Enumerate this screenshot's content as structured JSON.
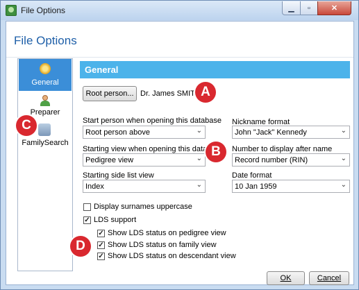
{
  "window": {
    "title": "File Options",
    "min_glyph": "▁",
    "max_glyph": "▫",
    "close_glyph": "✕"
  },
  "dialog": {
    "title": "File Options"
  },
  "sidebar": {
    "items": [
      {
        "label": "General",
        "icon": "gear-icon",
        "selected": true
      },
      {
        "label": "Preparer",
        "icon": "person-icon",
        "selected": false
      },
      {
        "label": "FamilySearch",
        "icon": "familysearch-icon",
        "selected": false
      }
    ]
  },
  "section": {
    "title": "General"
  },
  "root": {
    "button_label": "Root person...",
    "name": "Dr. James SMITH"
  },
  "fields": {
    "start_person": {
      "label": "Start person when opening this database",
      "value": "Root person above"
    },
    "starting_view": {
      "label": "Starting view when opening this database",
      "value": "Pedigree view"
    },
    "side_list": {
      "label": "Starting side list view",
      "value": "Index"
    },
    "nickname": {
      "label": "Nickname format",
      "value": "John \"Jack\" Kennedy"
    },
    "number_display": {
      "label": "Number to display after name",
      "value": "Record number (RIN)"
    },
    "date_format": {
      "label": "Date format",
      "value": "10 Jan 1959"
    }
  },
  "checkboxes": {
    "surnames_upper": {
      "label": "Display surnames uppercase",
      "checked": false
    },
    "lds_support": {
      "label": "LDS support",
      "checked": true
    },
    "lds_pedigree": {
      "label": "Show LDS status on pedigree view",
      "checked": true
    },
    "lds_family": {
      "label": "Show LDS status on family view",
      "checked": true
    },
    "lds_descendant": {
      "label": "Show LDS status on descendant view",
      "checked": true
    }
  },
  "check_glyph": "✓",
  "dropdown_glyph": "⌄",
  "buttons": {
    "ok_label": "OK",
    "cancel_label": "Cancel"
  },
  "callouts": {
    "a": "A",
    "b": "B",
    "c": "C",
    "d": "D"
  },
  "colors": {
    "section_bar": "#4cb3ea",
    "selected_item": "#3b8ed8",
    "callout": "#d9282f",
    "dialog_title": "#1e5fa8"
  }
}
